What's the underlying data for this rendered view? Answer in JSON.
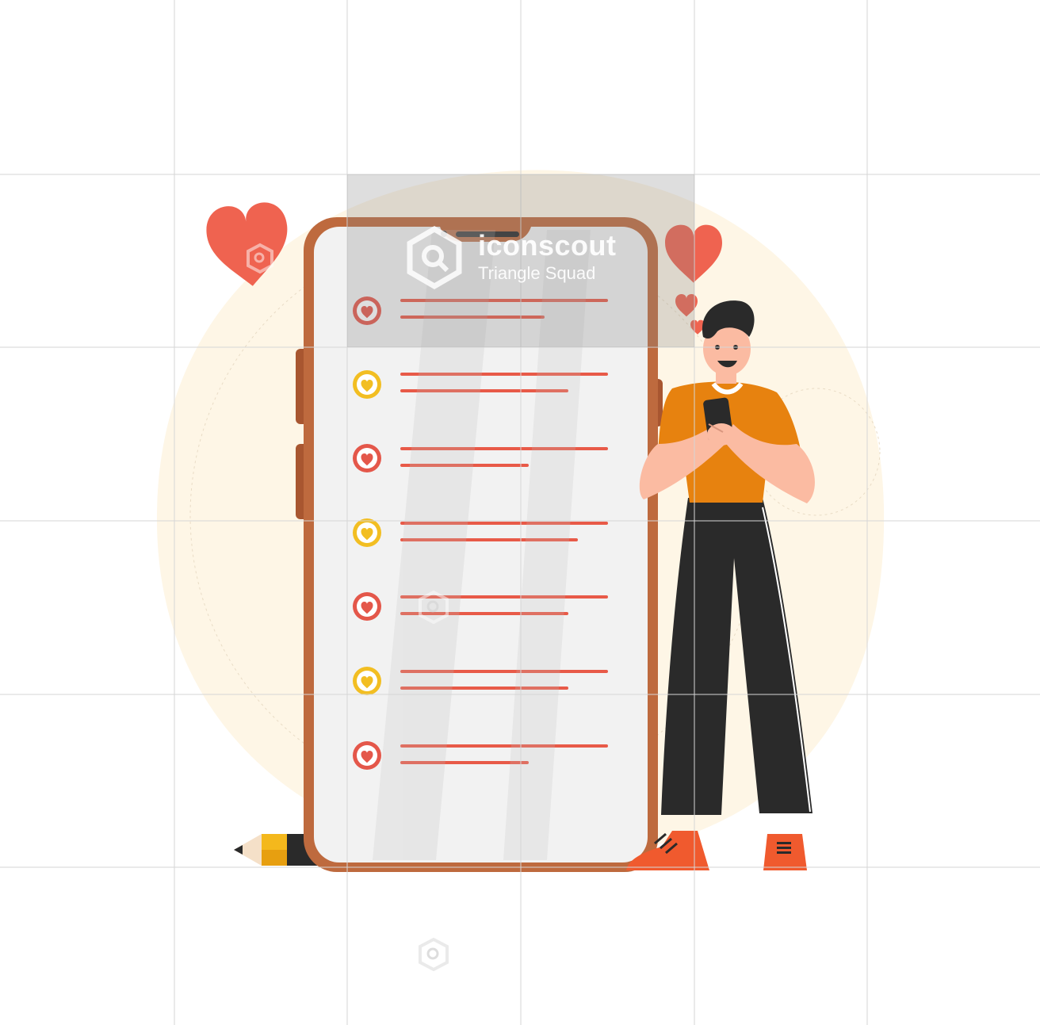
{
  "watermark": {
    "brand": "iconscout",
    "author": "Triangle Squad"
  },
  "colors": {
    "heart_red": "#E4574A",
    "heart_yellow": "#F2BE22",
    "phone_frame": "#BE6A3E",
    "line_red": "#E85A48",
    "shirt_orange": "#E7820F",
    "pants_black": "#2A2A2A",
    "skin": "#FBBBA2",
    "backdrop": "#FEF6E6"
  },
  "list_items": [
    {
      "icon": "heart-icon",
      "color": "red"
    },
    {
      "icon": "heart-icon",
      "color": "yellow"
    },
    {
      "icon": "heart-icon",
      "color": "red"
    },
    {
      "icon": "heart-icon",
      "color": "yellow"
    },
    {
      "icon": "heart-icon",
      "color": "red"
    },
    {
      "icon": "heart-icon",
      "color": "yellow"
    },
    {
      "icon": "heart-icon",
      "color": "red"
    }
  ],
  "scene": {
    "floating_hearts": [
      "heart-icon",
      "heart-icon",
      "heart-icon",
      "heart-icon"
    ],
    "person": "man-holding-smartphone",
    "prop": "pencil"
  }
}
